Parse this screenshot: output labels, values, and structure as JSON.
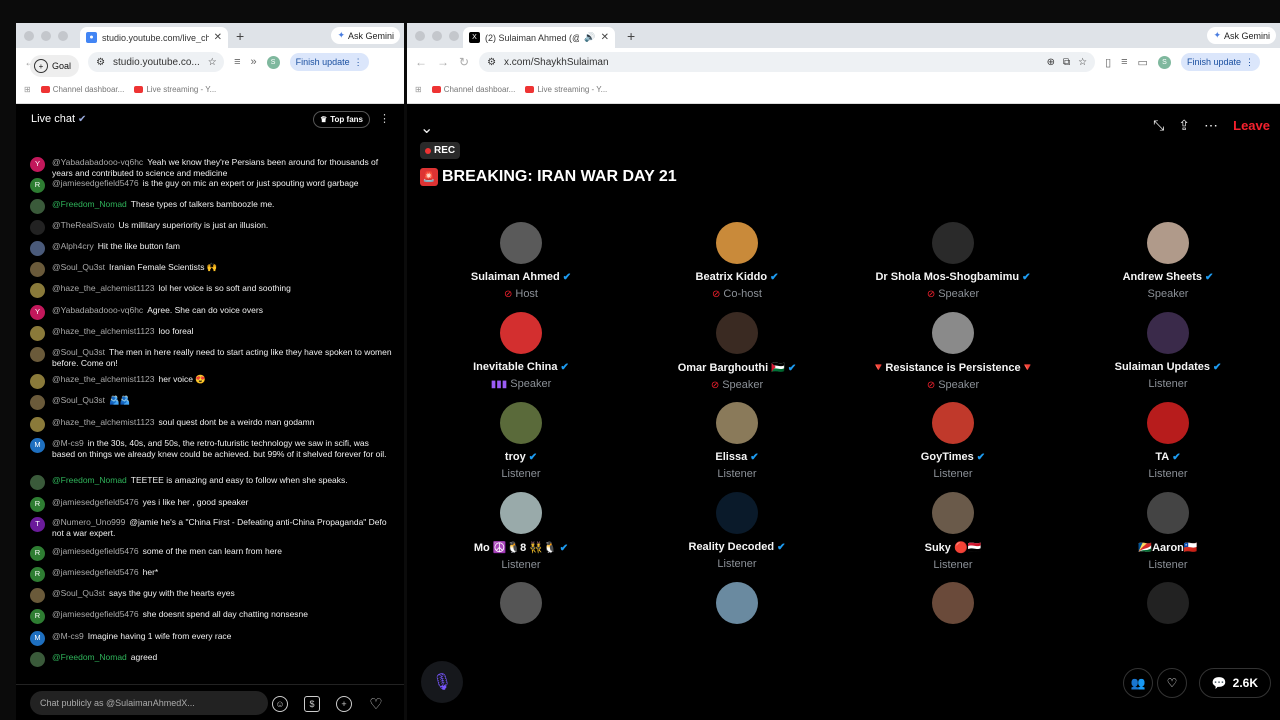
{
  "left_window": {
    "tab_title": "studio.youtube.com/live_chat",
    "ask_gemini": "Ask Gemini",
    "url": "studio.youtube.co...",
    "profile_letter": "S",
    "finish_update": "Finish update",
    "bookmarks": [
      "Channel dashboar...",
      "Live streaming - Y..."
    ]
  },
  "chat": {
    "title": "Live chat",
    "top_fans": "Top fans",
    "goal": "Goal",
    "input_placeholder": "Chat publicly as @SulaimanAhmedX...",
    "messages": [
      {
        "user": "@Yabadabadooo-vq6hc",
        "text": "Yeah we know they're Persians been around for thousands of years and contributed to science and medicine",
        "av": "Y",
        "avc": "#c2185b",
        "green": false
      },
      {
        "user": "@jamiesedgefield5476",
        "text": "is the guy on mic an expert or just spouting word garbage",
        "av": "R",
        "avc": "#2e7d32",
        "green": false
      },
      {
        "user": "@Freedom_Nomad",
        "text": "These types of talkers bamboozle me.",
        "av": "",
        "avc": "#3a5a3a",
        "green": true
      },
      {
        "user": "@TheRealSvato",
        "text": "Us millitary superiority is just an illusion.",
        "av": "",
        "avc": "#222",
        "green": false
      },
      {
        "user": "@Alph4cry",
        "text": "Hit the like button fam",
        "av": "",
        "avc": "#4a5a7a",
        "green": false
      },
      {
        "user": "@Soul_Qu3st",
        "text": "Iranian Female Scientists 🙌",
        "av": "",
        "avc": "#6a5a3a",
        "green": false
      },
      {
        "user": "@haze_the_alchemist1123",
        "text": "lol her voice is so soft and soothing",
        "av": "",
        "avc": "#8a7a3a",
        "green": false
      },
      {
        "user": "@Yabadabadooo-vq6hc",
        "text": "Agree. She can do voice overs",
        "av": "Y",
        "avc": "#c2185b",
        "green": false
      },
      {
        "user": "@haze_the_alchemist1123",
        "text": "loo foreal",
        "av": "",
        "avc": "#8a7a3a",
        "green": false
      },
      {
        "user": "@Soul_Qu3st",
        "text": "The men in here really need to start acting like they have spoken to women before. Come on!",
        "av": "",
        "avc": "#6a5a3a",
        "green": false
      },
      {
        "user": "@haze_the_alchemist1123",
        "text": "her voice 😍",
        "av": "",
        "avc": "#8a7a3a",
        "green": false
      },
      {
        "user": "@Soul_Qu3st",
        "text": "🫂🫂",
        "av": "",
        "avc": "#6a5a3a",
        "green": false
      },
      {
        "user": "@haze_the_alchemist1123",
        "text": "soul quest dont be a weirdo man godamn",
        "av": "",
        "avc": "#8a7a3a",
        "green": false
      },
      {
        "user": "@M-cs9",
        "text": "in the 30s, 40s, and 50s, the retro-futuristic technology we saw in scifi, was based on things we already knew could be achieved. but 99% of it shelved forever for oil.",
        "av": "M",
        "avc": "#1e6fbf",
        "green": false
      },
      {
        "user": "@Freedom_Nomad",
        "text": "TEETEE is amazing and easy to follow when she speaks.",
        "av": "",
        "avc": "#3a5a3a",
        "green": true
      },
      {
        "user": "@jamiesedgefield5476",
        "text": "yes i like her , good speaker",
        "av": "R",
        "avc": "#2e7d32",
        "green": false
      },
      {
        "user": "@Numero_Uno999",
        "text": "@jamie he's a \"China First - Defeating anti-China Propaganda\" Defo not a war expert.",
        "av": "T",
        "avc": "#6a1b9a",
        "green": false
      },
      {
        "user": "@jamiesedgefield5476",
        "text": "some of the men can learn from here",
        "av": "R",
        "avc": "#2e7d32",
        "green": false
      },
      {
        "user": "@jamiesedgefield5476",
        "text": "her*",
        "av": "R",
        "avc": "#2e7d32",
        "green": false
      },
      {
        "user": "@Soul_Qu3st",
        "text": "says the guy with the hearts eyes",
        "av": "",
        "avc": "#6a5a3a",
        "green": false
      },
      {
        "user": "@jamiesedgefield5476",
        "text": "she doesnt spend all day chatting nonsesne",
        "av": "R",
        "avc": "#2e7d32",
        "green": false
      },
      {
        "user": "@M-cs9",
        "text": "Imagine having 1 wife from every race",
        "av": "M",
        "avc": "#1e6fbf",
        "green": false
      },
      {
        "user": "@Freedom_Nomad",
        "text": "agreed",
        "av": "",
        "avc": "#3a5a3a",
        "green": true
      }
    ]
  },
  "right_window": {
    "tab_title": "(2) Sulaiman Ahmed (@S",
    "ask_gemini": "Ask Gemini",
    "url": "x.com/ShaykhSulaiman",
    "profile_letter": "S",
    "finish_update": "Finish update",
    "bookmarks": [
      "Channel dashboar...",
      "Live streaming - Y..."
    ]
  },
  "space": {
    "leave": "Leave",
    "rec": "REC",
    "title": "BREAKING: IRAN WAR DAY 21",
    "replies_count": "2.6K",
    "people": [
      {
        "name": "Sulaiman Ahmed",
        "role": "Host",
        "verified": true,
        "icon": "mute",
        "color": "#5a5a5a"
      },
      {
        "name": "Beatrix Kiddo",
        "role": "Co-host",
        "verified": true,
        "icon": "mute",
        "color": "#c98a3a"
      },
      {
        "name": "Dr Shola Mos-Shogbamimu",
        "role": "Speaker",
        "verified": true,
        "icon": "mute",
        "color": "#2a2a2a"
      },
      {
        "name": "Andrew Sheets",
        "role": "Speaker",
        "verified": true,
        "icon": "",
        "color": "#b09a8a"
      },
      {
        "name": "Inevitable China",
        "role": "Speaker",
        "verified": true,
        "icon": "speak",
        "color": "#d32f2f"
      },
      {
        "name": "Omar Barghouthi 🇵🇸",
        "role": "Speaker",
        "verified": true,
        "icon": "mute",
        "color": "#3a2a22"
      },
      {
        "name": "🔻Resistance is Persistence🔻",
        "role": "Speaker",
        "verified": false,
        "icon": "mute",
        "color": "#8a8a8a"
      },
      {
        "name": "Sulaiman Updates",
        "role": "Listener",
        "verified": true,
        "icon": "",
        "color": "#3a2a4a"
      },
      {
        "name": "troy",
        "role": "Listener",
        "verified": true,
        "icon": "",
        "color": "#5a6a3a"
      },
      {
        "name": "Elissa",
        "role": "Listener",
        "verified": true,
        "icon": "",
        "color": "#8a7a5a"
      },
      {
        "name": "GoyTimes",
        "role": "Listener",
        "verified": true,
        "icon": "",
        "color": "#c0392b"
      },
      {
        "name": "TA",
        "role": "Listener",
        "verified": true,
        "icon": "",
        "color": "#b71c1c"
      },
      {
        "name": "Mo ☮️🐧8 👯🐧",
        "role": "Listener",
        "verified": true,
        "icon": "",
        "color": "#9aa"
      },
      {
        "name": "Reality Decoded",
        "role": "Listener",
        "verified": true,
        "icon": "",
        "color": "#0a1a2a"
      },
      {
        "name": "Suky 🔴🇾🇪",
        "role": "Listener",
        "verified": false,
        "icon": "",
        "color": "#6a5a4a"
      },
      {
        "name": "🇸🇨Aaron🇨🇱",
        "role": "Listener",
        "verified": false,
        "icon": "",
        "color": "#444"
      },
      {
        "name": "",
        "role": "",
        "verified": false,
        "icon": "",
        "color": "#555"
      },
      {
        "name": "",
        "role": "",
        "verified": false,
        "icon": "",
        "color": "#6a8aa0"
      },
      {
        "name": "",
        "role": "",
        "verified": false,
        "icon": "",
        "color": "#6a4a3a"
      },
      {
        "name": "",
        "role": "",
        "verified": false,
        "icon": "",
        "color": "#222"
      }
    ]
  }
}
